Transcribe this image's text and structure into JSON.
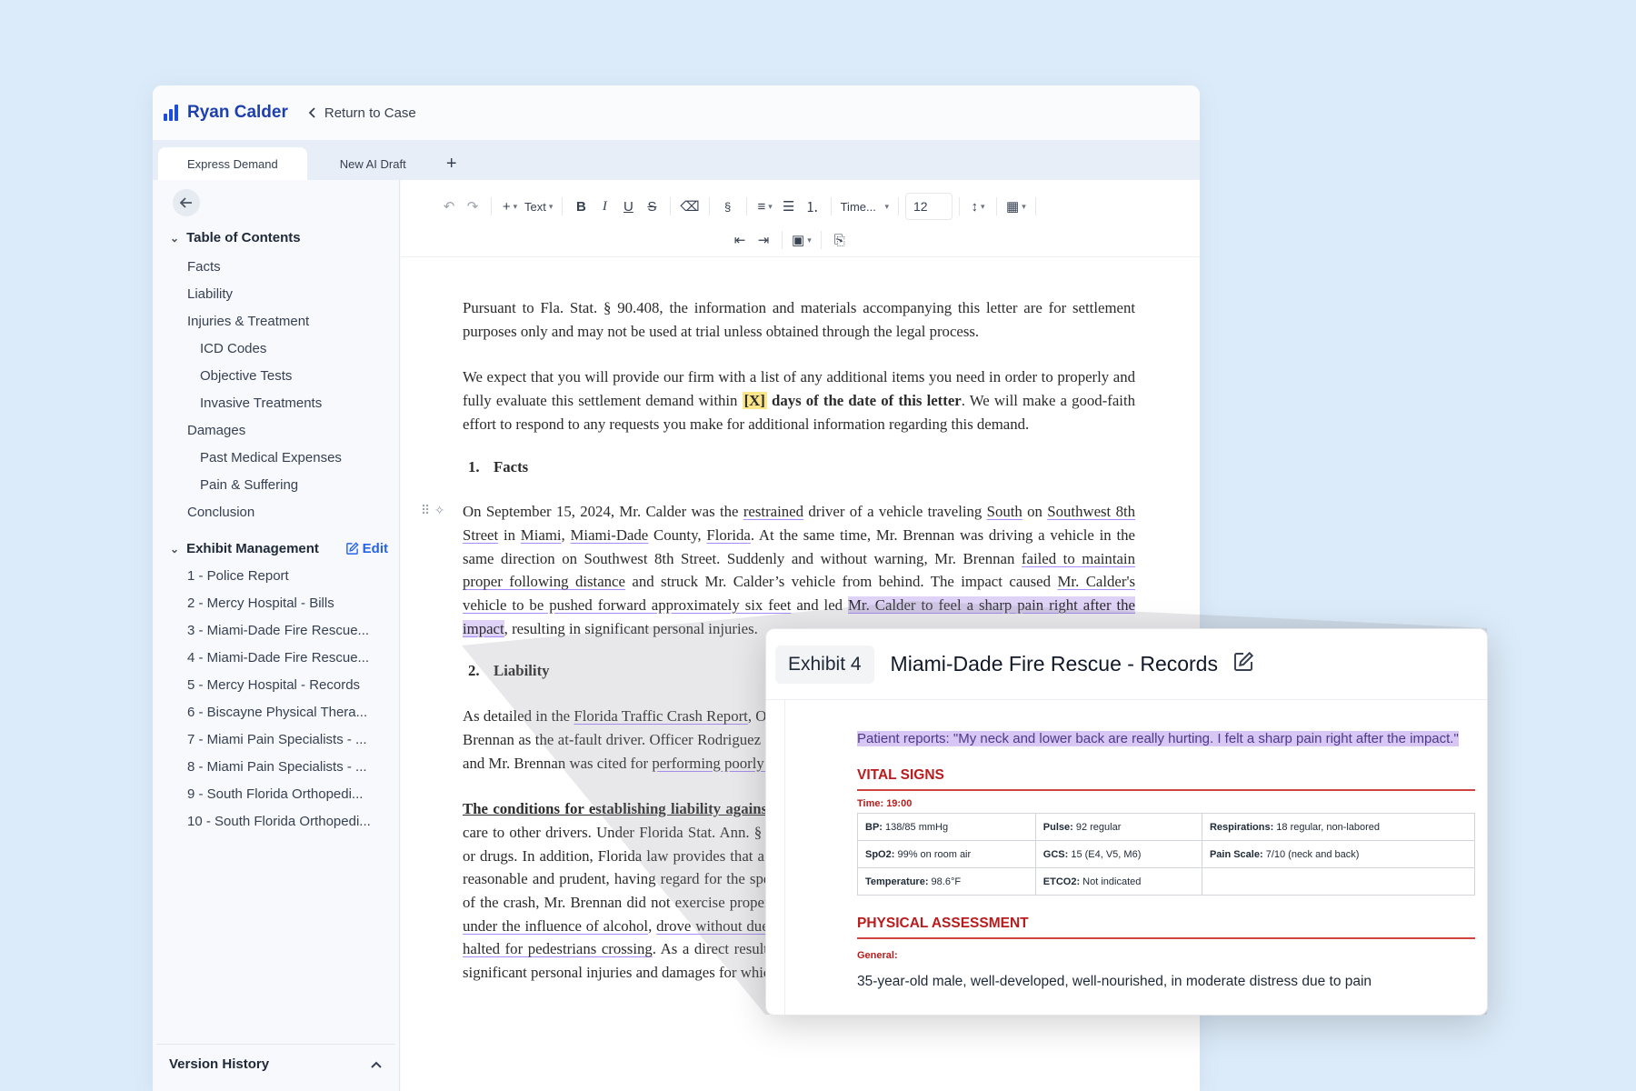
{
  "header": {
    "brand": "Ryan Calder",
    "back_label": "Return to Case"
  },
  "tabs": [
    {
      "label": "Express Demand",
      "active": true
    },
    {
      "label": "New AI Draft",
      "active": false
    }
  ],
  "toolbar": {
    "text_style": "Text",
    "font": "Time...",
    "font_size": "12",
    "section_symbol": "§"
  },
  "toc": {
    "title": "Table of Contents",
    "items": [
      {
        "label": "Facts",
        "level": 1
      },
      {
        "label": "Liability",
        "level": 1
      },
      {
        "label": "Injuries & Treatment",
        "level": 1
      },
      {
        "label": "ICD Codes",
        "level": 2
      },
      {
        "label": "Objective Tests",
        "level": 2
      },
      {
        "label": "Invasive Treatments",
        "level": 2
      },
      {
        "label": "Damages",
        "level": 1
      },
      {
        "label": "Past Medical Expenses",
        "level": 2
      },
      {
        "label": "Pain & Suffering",
        "level": 2
      },
      {
        "label": "Conclusion",
        "level": 1
      }
    ]
  },
  "exhibits": {
    "title": "Exhibit Management",
    "edit_label": "Edit",
    "items": [
      "1 - Police Report",
      "2 - Mercy Hospital - Bills",
      "3 - Miami-Dade Fire Rescue...",
      "4 - Miami-Dade Fire Rescue...",
      "5 - Mercy Hospital - Records",
      "6 - Biscayne Physical Thera...",
      "7 - Miami Pain Specialists - ...",
      "8 - Miami Pain Specialists - ...",
      "9 - South Florida Orthopedi...",
      "10 - South Florida Orthopedi..."
    ]
  },
  "version_history": {
    "label": "Version History"
  },
  "document": {
    "p1": "Pursuant to Fla. Stat. § 90.408, the information and materials accompanying this letter are for settlement purposes only and may not be used at trial unless obtained through the legal process.",
    "p2a": "We expect that you will provide our firm with a list of any additional items you need in order to properly and fully evaluate this settlement demand within ",
    "p2_placeholder": "[X]",
    "p2_bold": " days of the date of this letter",
    "p2b": ". We will make a good-faith effort to respond to any requests you make for additional information regarding this demand.",
    "h1_num": "1.",
    "h1": "Facts",
    "facts": [
      {
        "t": "On September 15, 2024, Mr. Calder was the "
      },
      {
        "t": "restrained",
        "u": true
      },
      {
        "t": " driver of a vehicle traveling "
      },
      {
        "t": "South",
        "u": true
      },
      {
        "t": " on "
      },
      {
        "t": "Southwest 8th Street",
        "u": true
      },
      {
        "t": " in "
      },
      {
        "t": "Miami",
        "u": true
      },
      {
        "t": ", "
      },
      {
        "t": "Miami-Dade",
        "u": true
      },
      {
        "t": " County, "
      },
      {
        "t": "Florida",
        "u": true
      },
      {
        "t": ". At the same time, Mr. Brennan was driving a vehicle in the same direction on Southwest 8th Street. Suddenly and without warning, Mr. Brennan "
      },
      {
        "t": "failed to maintain proper following distance",
        "u": true
      },
      {
        "t": " and struck Mr. Calder’s vehicle from behind. The impact caused "
      },
      {
        "t": "Mr. Calder's vehicle to be pushed forward approximately six feet",
        "u": true
      },
      {
        "t": " and led "
      },
      {
        "t": "Mr. Calder to feel a sharp pain right after the impact",
        "u": true,
        "sel": true
      },
      {
        "t": ", resulting in significant personal injuries."
      }
    ],
    "h2_num": "2.",
    "h2": "Liability",
    "liab": [
      {
        "t": "As detailed in the "
      },
      {
        "t": "Florida Traffic Crash Report",
        "u": true
      },
      {
        "t": ", Officer Rodriguez investigated the accident and identified Mr. Brennan as the at-fault driver. Officer Rodriguez found that Mr. Brennan was solely responsible for the crash, and Mr. Brennan was cited for "
      },
      {
        "t": "performing poorly on field sobriety tests",
        "u": true
      },
      {
        "t": "."
      }
    ],
    "cond_title": "The conditions for establishing liability against Mr. Brennan",
    "cond": [
      {
        "t": " are clear. Drivers owe a duty of reasonable care to other drivers. Under Florida Stat. Ann. § 316.193, a person may not drive while impaired by alcohol or drugs. In addition, Florida law provides that a driver shall not follow another vehicle more closely than is reasonable and prudent, having regard for the speed, road conditions, and other relevant factors. On the date of the crash, Mr. Brennan did not exercise proper care. He "
      },
      {
        "t": "failed to maintain proper following distance",
        "u": true
      },
      {
        "t": ", was "
      },
      {
        "t": "under the influence of alcohol",
        "u": true
      },
      {
        "t": ", "
      },
      {
        "t": "drove without due regard for the traffic ahead",
        "u": true
      },
      {
        "t": " and struck Mr. "
      },
      {
        "t": "Calder's vehicle halted for pedestrians crossing",
        "u": true
      },
      {
        "t": ". As a direct result of the crash on September 15, 2024, Mr. Calder sustained significant personal injuries and damages for which Mr. Brennan is liable."
      }
    ]
  },
  "popup": {
    "exhibit_label": "Exhibit 4",
    "title": "Miami-Dade Fire Rescue - Records",
    "quote": "Patient reports: \"My neck and lower back are really hurting. I felt a sharp pain right after the impact.\"",
    "vital_title": "VITAL SIGNS",
    "time": "Time: 19:00",
    "vitals": [
      [
        {
          "k": "BP:",
          "v": " 138/85 mmHg"
        },
        {
          "k": "Pulse:",
          "v": " 92 regular"
        },
        {
          "k": "Respirations:",
          "v": " 18 regular, non-labored"
        }
      ],
      [
        {
          "k": "SpO2:",
          "v": " 99% on room air"
        },
        {
          "k": "GCS:",
          "v": " 15 (E4, V5, M6)"
        },
        {
          "k": "Pain Scale:",
          "v": " 7/10 (neck and back)"
        }
      ],
      [
        {
          "k": "Temperature:",
          "v": " 98.6°F"
        },
        {
          "k": "ETCO2:",
          "v": " Not indicated"
        },
        {
          "k": "",
          "v": ""
        }
      ]
    ],
    "phys_title": "PHYSICAL ASSESSMENT",
    "general_label": "General:",
    "general_text": "35-year-old male, well-developed, well-nourished, in moderate distress due to pain"
  },
  "colors": {
    "brand": "#1e40af",
    "link": "#2563eb",
    "record_red": "#b91c1c",
    "selection": "#ded2f7",
    "placeholder_highlight": "#fde68a"
  }
}
